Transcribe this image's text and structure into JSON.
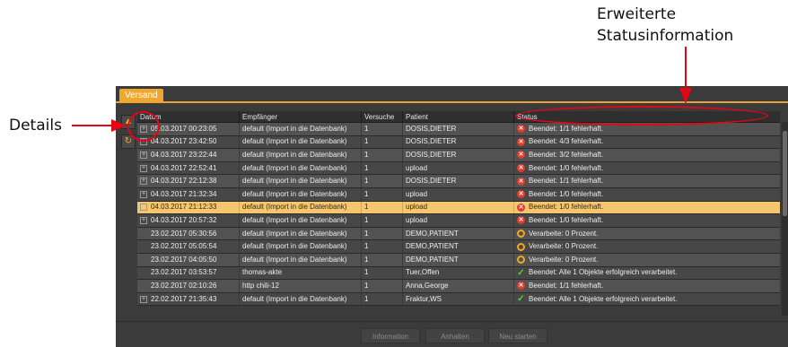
{
  "annotations": {
    "status_callout": "Erweiterte\nStatusinformation",
    "details_callout": "Details"
  },
  "tab": {
    "label": "Versand"
  },
  "columns": {
    "datum": "Datum",
    "empfaenger": "Empfänger",
    "versuche": "Versuche",
    "patient": "Patient",
    "status": "Status"
  },
  "rows": [
    {
      "expand": true,
      "datum": "05.03.2017 00:23:05",
      "empfaenger": "default (Import in die Datenbank)",
      "versuche": "1",
      "patient": "DOSIS,DIETER",
      "status_icon": "error",
      "status": "Beendet: 1/1 fehlerhaft."
    },
    {
      "expand": true,
      "datum": "04.03.2017 23:42:50",
      "empfaenger": "default (Import in die Datenbank)",
      "versuche": "1",
      "patient": "DOSIS,DIETER",
      "status_icon": "error",
      "status": "Beendet: 4/3 fehlerhaft."
    },
    {
      "expand": true,
      "datum": "04.03.2017 23:22:44",
      "empfaenger": "default (Import in die Datenbank)",
      "versuche": "1",
      "patient": "DOSIS,DIETER",
      "status_icon": "error",
      "status": "Beendet: 3/2 fehlerhaft."
    },
    {
      "expand": true,
      "datum": "04.03.2017 22:52:41",
      "empfaenger": "default (Import in die Datenbank)",
      "versuche": "1",
      "patient": "upload",
      "status_icon": "error",
      "status": "Beendet: 1/0 fehlerhaft."
    },
    {
      "expand": true,
      "datum": "04.03.2017 22:12:38",
      "empfaenger": "default (Import in die Datenbank)",
      "versuche": "1",
      "patient": "DOSIS,DIETER",
      "status_icon": "error",
      "status": "Beendet: 1/1 fehlerhaft."
    },
    {
      "expand": true,
      "datum": "04.03.2017 21:32:34",
      "empfaenger": "default (Import in die Datenbank)",
      "versuche": "1",
      "patient": "upload",
      "status_icon": "error",
      "status": "Beendet: 1/0 fehlerhaft."
    },
    {
      "expand": true,
      "selected": true,
      "datum": "04.03.2017 21:12:33",
      "empfaenger": "default (Import in die Datenbank)",
      "versuche": "1",
      "patient": "upload",
      "status_icon": "error",
      "status": "Beendet: 1/0 fehlerhaft."
    },
    {
      "expand": true,
      "datum": "04.03.2017 20:57:32",
      "empfaenger": "default (Import in die Datenbank)",
      "versuche": "1",
      "patient": "upload",
      "status_icon": "error",
      "status": "Beendet: 1/0 fehlerhaft."
    },
    {
      "expand": false,
      "datum": "23.02.2017 05:30:56",
      "empfaenger": "default (Import in die Datenbank)",
      "versuche": "1",
      "patient": "DEMO,PATIENT",
      "status_icon": "progress",
      "status": "Verarbeite: 0 Prozent."
    },
    {
      "expand": false,
      "datum": "23.02.2017 05:05:54",
      "empfaenger": "default (Import in die Datenbank)",
      "versuche": "1",
      "patient": "DEMO,PATIENT",
      "status_icon": "progress",
      "status": "Verarbeite: 0 Prozent."
    },
    {
      "expand": false,
      "datum": "23.02.2017 04:05:50",
      "empfaenger": "default (Import in die Datenbank)",
      "versuche": "1",
      "patient": "DEMO,PATIENT",
      "status_icon": "progress",
      "status": "Verarbeite: 0 Prozent."
    },
    {
      "expand": false,
      "datum": "23.02.2017 03:53:57",
      "empfaenger": "thomas-akte",
      "versuche": "1",
      "patient": "Tuer,Offen",
      "status_icon": "ok",
      "status": "Beendet: Alle 1 Objekte erfolgreich verarbeitet."
    },
    {
      "expand": false,
      "datum": "23.02.2017 02:10:26",
      "empfaenger": "http chili-12",
      "versuche": "1",
      "patient": "Anna,George",
      "status_icon": "error",
      "status": "Beendet: 1/1 fehlerhaft."
    },
    {
      "expand": true,
      "datum": "22.02.2017 21:35:43",
      "empfaenger": "default (Import in die Datenbank)",
      "versuche": "1",
      "patient": "Fraktur,WS",
      "status_icon": "ok",
      "status": "Beendet: Alle 1 Objekte erfolgreich verarbeitet."
    }
  ],
  "footer": {
    "information": "Information",
    "anhalten": "Anhalten",
    "neu_starten": "Neu starten"
  },
  "colors": {
    "accent": "#f0a72e",
    "selected_row": "#f4c66e",
    "annotation_red": "#e30613"
  }
}
